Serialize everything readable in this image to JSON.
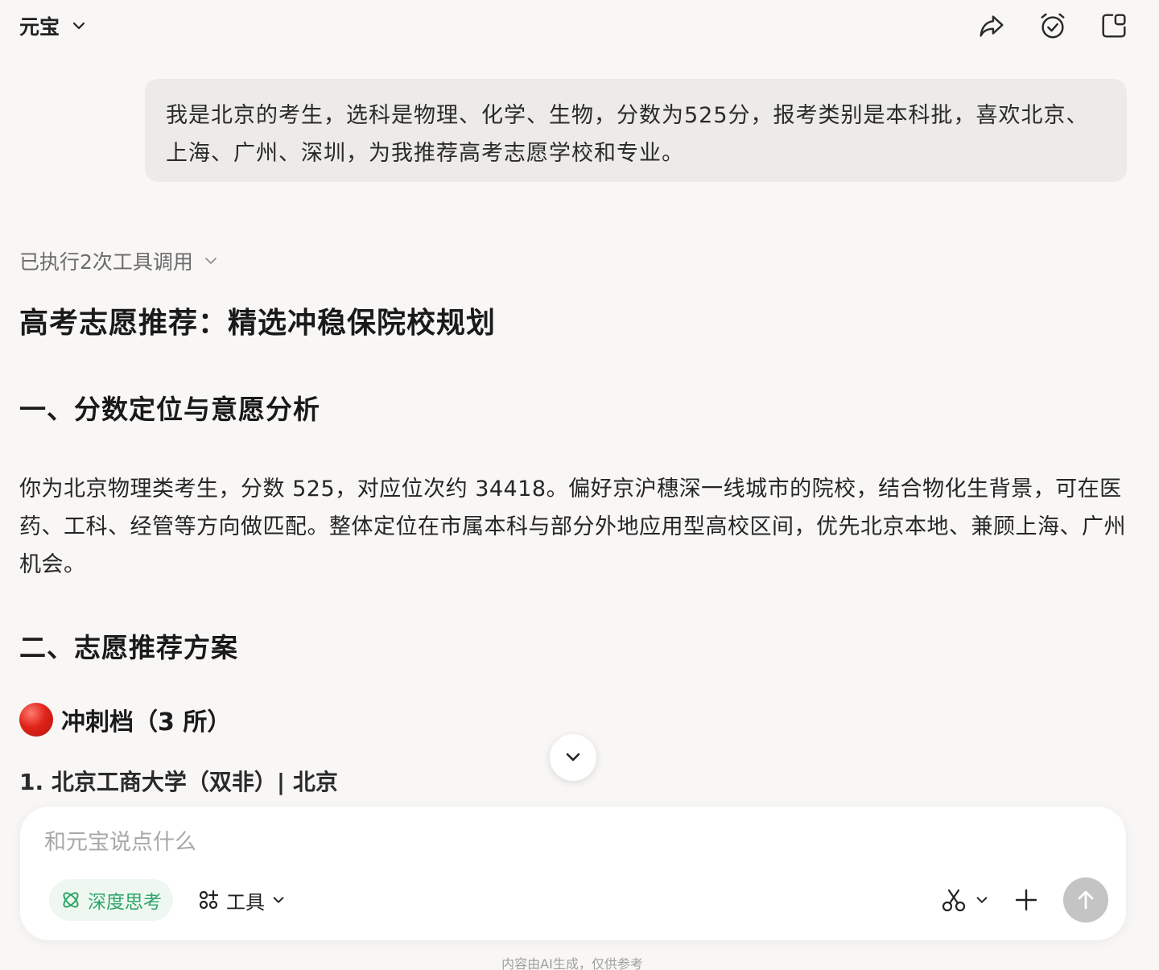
{
  "header": {
    "app_name": "元宝",
    "icons": [
      "share-icon",
      "alarm-check-icon",
      "new-chat-icon"
    ]
  },
  "user_message": "我是北京的考生，选科是物理、化学、生物，分数为525分，报考类别是本科批，喜欢北京、上海、广州、深圳，为我推荐高考志愿学校和专业。",
  "response": {
    "tool_calls_label": "已执行2次工具调用",
    "title": "高考志愿推荐：精选冲稳保院校规划",
    "section1_heading": "一、分数定位与意愿分析",
    "section1_body": "你为北京物理类考生，分数 525，对应位次约 34418。偏好京沪穗深一线城市的院校，结合物化生背景，可在医药、工科、经管等方向做匹配。整体定位在市属本科与部分外地应用型高校区间，优先北京本地、兼顾上海、广州机会。",
    "section2_heading": "二、志愿推荐方案",
    "tier_label": "冲刺档（3 所）",
    "school_1": "1. 北京工商大学（双非）| 北京"
  },
  "composer": {
    "placeholder": "和元宝说点什么",
    "deep_think_label": "深度思考",
    "tools_label": "工具"
  },
  "footer": {
    "disclaimer": "内容由AI生成，仅供参考"
  },
  "colors": {
    "background": "#f8f7f5",
    "user_bubble": "#ecebe8",
    "deep_think_green": "#2fa56a",
    "send_button": "#c4c4c4"
  }
}
